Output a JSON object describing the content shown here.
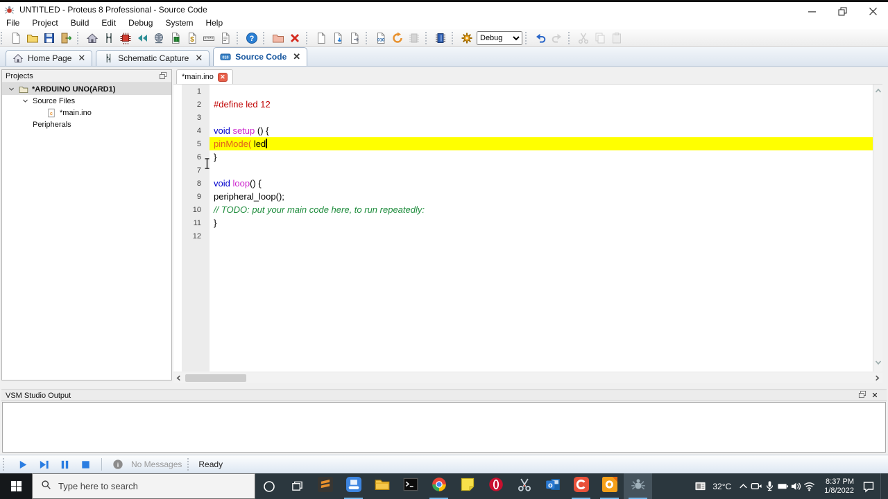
{
  "window": {
    "title": "UNTITLED - Proteus 8 Professional - Source Code"
  },
  "menu": [
    "File",
    "Project",
    "Build",
    "Edit",
    "Debug",
    "System",
    "Help"
  ],
  "toolbar": {
    "groups": [
      {
        "items": [
          {
            "name": "new-project-button",
            "icon": "newdoc"
          },
          {
            "name": "open-project-button",
            "icon": "folder"
          },
          {
            "name": "save-project-button",
            "icon": "save"
          },
          {
            "name": "import-project-button",
            "icon": "door"
          }
        ]
      },
      {
        "items": [
          {
            "name": "home-page-button",
            "icon": "home"
          },
          {
            "name": "schematic-capture-button",
            "icon": "schem"
          },
          {
            "name": "pcb-layout-button",
            "icon": "pcb"
          },
          {
            "name": "back-annotate-button",
            "icon": "backs"
          },
          {
            "name": "3d-visualizer-button",
            "icon": "globe"
          },
          {
            "name": "design-explorer-button",
            "icon": "greendoc"
          },
          {
            "name": "bill-of-materials-button",
            "icon": "bomdoc"
          },
          {
            "name": "measurement-button",
            "icon": "ruler"
          },
          {
            "name": "design-notes-button",
            "icon": "report"
          }
        ]
      },
      {
        "items": [
          {
            "name": "help-button",
            "icon": "help"
          }
        ]
      },
      {
        "items": [
          {
            "name": "open-source-file-button",
            "icon": "pinkfolder"
          },
          {
            "name": "close-source-file-button",
            "icon": "redx"
          }
        ]
      },
      {
        "items": [
          {
            "name": "new-source-file-button",
            "icon": "newdoc"
          },
          {
            "name": "import-source-file-button",
            "icon": "docimp"
          },
          {
            "name": "export-source-file-button",
            "icon": "docexp"
          }
        ]
      },
      {
        "items": [
          {
            "name": "build-project-button",
            "icon": "builddoc"
          },
          {
            "name": "rebuild-project-button",
            "icon": "rebuild"
          },
          {
            "name": "program-chip-button",
            "icon": "graychip",
            "disabled": true
          }
        ]
      },
      {
        "items": [
          {
            "name": "debug-chip-button",
            "icon": "bluechip"
          }
        ]
      },
      {
        "items": [
          {
            "name": "settings-gear-button",
            "icon": "gear"
          },
          {
            "name": "debug-config-select",
            "type": "select",
            "value": "Debug"
          }
        ]
      },
      {
        "items": [
          {
            "name": "undo-button",
            "icon": "undo"
          },
          {
            "name": "redo-button",
            "icon": "redo",
            "disabled": true
          }
        ]
      },
      {
        "items": [
          {
            "name": "cut-button",
            "icon": "cut",
            "disabled": true
          },
          {
            "name": "copy-button",
            "icon": "copy",
            "disabled": true
          },
          {
            "name": "paste-button",
            "icon": "paste",
            "disabled": true
          }
        ]
      }
    ]
  },
  "app_tabs": [
    {
      "label": "Home Page",
      "icon": "tabhome",
      "active": false
    },
    {
      "label": "Schematic Capture",
      "icon": "tabschem",
      "active": false
    },
    {
      "label": "Source Code",
      "icon": "tabsrc",
      "active": true
    }
  ],
  "projects_panel": {
    "title": "Projects",
    "tree": [
      {
        "indent": 0,
        "chevron": true,
        "icon": "treefolder",
        "label": "*ARDUINO UNO(ARD1)",
        "selected": true,
        "bold": true
      },
      {
        "indent": 1,
        "chevron": true,
        "icon": "",
        "label": "Source Files",
        "selected": false,
        "bold": false
      },
      {
        "indent": 2,
        "chevron": false,
        "icon": "cfile",
        "label": "*main.ino",
        "selected": false,
        "bold": false
      },
      {
        "indent": 1,
        "chevron": false,
        "icon": "",
        "label": "Peripherals",
        "selected": false,
        "bold": false
      }
    ]
  },
  "editor": {
    "tab_label": "*main.ino",
    "lines": [
      {
        "n": 1,
        "tokens": [],
        "hl": false,
        "caret": false
      },
      {
        "n": 2,
        "tokens": [
          {
            "c": "red",
            "t": "#define led 12"
          }
        ],
        "hl": false,
        "caret": false
      },
      {
        "n": 3,
        "tokens": [],
        "hl": false,
        "caret": false
      },
      {
        "n": 4,
        "tokens": [
          {
            "c": "kw",
            "t": "void "
          },
          {
            "c": "fn",
            "t": "setup"
          },
          {
            "c": "pl",
            "t": " () {"
          }
        ],
        "hl": false,
        "caret": false
      },
      {
        "n": 5,
        "tokens": [
          {
            "c": "call",
            "t": "pinMode("
          },
          {
            "c": "pl",
            "t": " led"
          }
        ],
        "hl": true,
        "caret": true
      },
      {
        "n": 6,
        "tokens": [
          {
            "c": "pl",
            "t": "}"
          }
        ],
        "hl": false,
        "caret": false
      },
      {
        "n": 7,
        "tokens": [],
        "hl": false,
        "caret": false
      },
      {
        "n": 8,
        "tokens": [
          {
            "c": "kw",
            "t": "void "
          },
          {
            "c": "fn",
            "t": "loop"
          },
          {
            "c": "pl",
            "t": "() {"
          }
        ],
        "hl": false,
        "caret": false
      },
      {
        "n": 9,
        "tokens": [
          {
            "c": "pl",
            "t": "peripheral_loop();"
          }
        ],
        "hl": false,
        "caret": false
      },
      {
        "n": 10,
        "tokens": [
          {
            "c": "cm",
            "t": "// TODO: put your main code here, to run repeatedly:"
          }
        ],
        "hl": false,
        "caret": false
      },
      {
        "n": 11,
        "tokens": [
          {
            "c": "pl",
            "t": "}"
          }
        ],
        "hl": false,
        "caret": false
      },
      {
        "n": 12,
        "tokens": [],
        "hl": false,
        "caret": false
      }
    ]
  },
  "output_panel": {
    "title": "VSM Studio Output"
  },
  "status_bar": {
    "buttons": [
      {
        "name": "play-button",
        "icon": "play"
      },
      {
        "name": "step-button",
        "icon": "step"
      },
      {
        "name": "pause-button",
        "icon": "pause"
      },
      {
        "name": "stop-button",
        "icon": "stop"
      }
    ],
    "no_messages": "No Messages",
    "ready": "Ready"
  },
  "taskbar": {
    "search_placeholder": "Type here to search",
    "apps": [
      {
        "name": "sublime-text",
        "icon": "sublime",
        "underline": false,
        "active": false
      },
      {
        "name": "ev-capture",
        "icon": "ev",
        "underline": true,
        "active": false
      },
      {
        "name": "file-explorer",
        "icon": "explorer",
        "underline": false,
        "active": false
      },
      {
        "name": "command-prompt",
        "icon": "cmd",
        "underline": false,
        "active": false
      },
      {
        "name": "chrome",
        "icon": "chrome",
        "underline": true,
        "active": false
      },
      {
        "name": "sticky-notes",
        "icon": "sticky",
        "underline": false,
        "active": false
      },
      {
        "name": "opera",
        "icon": "opera",
        "underline": false,
        "active": false
      },
      {
        "name": "snipping-tool",
        "icon": "snip",
        "underline": false,
        "active": false
      },
      {
        "name": "outlook",
        "icon": "outlook",
        "underline": false,
        "active": false
      },
      {
        "name": "camtasia",
        "icon": "camtasia",
        "underline": true,
        "active": false
      },
      {
        "name": "gom-player",
        "icon": "gom",
        "underline": true,
        "active": false
      },
      {
        "name": "proteus",
        "icon": "proteusbug",
        "underline": true,
        "active": true
      }
    ],
    "tray": {
      "temperature": "32°C",
      "time": "8:37 PM",
      "date": "1/8/2022",
      "icons": [
        "news-widget",
        "chevron-up",
        "screen-recorder",
        "microphone",
        "battery",
        "speaker",
        "wifi"
      ]
    }
  }
}
